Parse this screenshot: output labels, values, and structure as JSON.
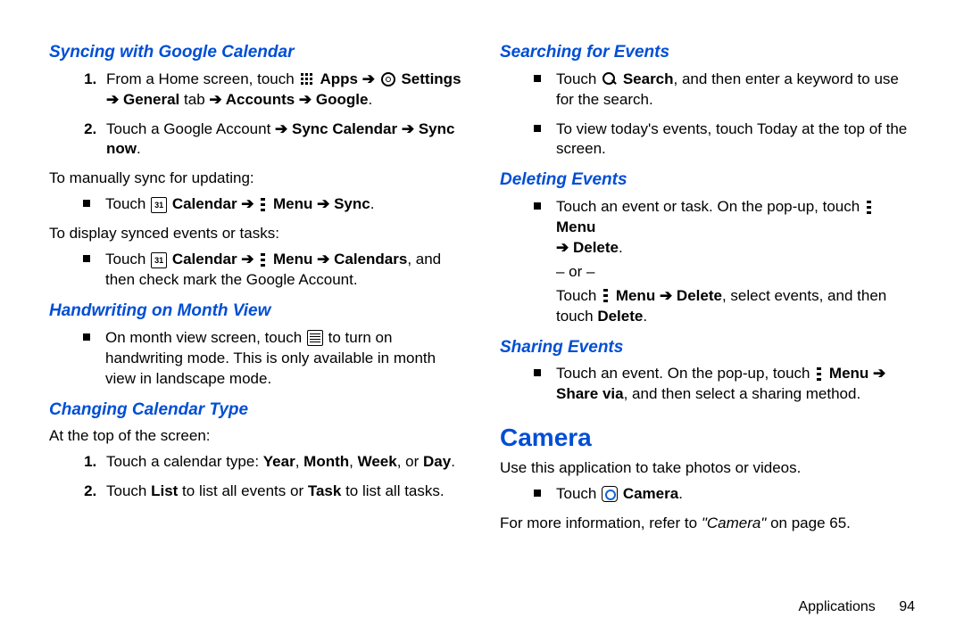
{
  "left": {
    "sync": {
      "heading": "Syncing with Google Calendar",
      "step1_a": "From a Home screen, touch ",
      "step1_apps": " Apps ",
      "step1_settings": " Settings ",
      "step1_b": " General",
      "step1_c": " tab ",
      "step1_d": " Accounts ",
      "step1_e": " Google",
      "step2_a": "Touch a Google Account ",
      "step2_b": " Sync Calendar ",
      "step2_c": " Sync now",
      "manual": "To manually sync for updating:",
      "bullet1_a": "Touch ",
      "bullet1_cal": " Calendar ",
      "bullet1_menu": " Menu ",
      "bullet1_sync": " Sync",
      "display": "To display synced events or tasks:",
      "bullet2_a": "Touch ",
      "bullet2_cal": " Calendar ",
      "bullet2_menu": " Menu ",
      "bullet2_cals": " Calendars",
      "bullet2_end": ", and then check mark the Google Account."
    },
    "handwriting": {
      "heading": "Handwriting on Month View",
      "bullet_a": "On month view screen, touch ",
      "bullet_b": " to turn on handwriting mode. This is only available in month view in landscape mode."
    },
    "changing": {
      "heading": "Changing Calendar Type",
      "intro": "At the top of the screen:",
      "step1_a": "Touch a calendar type: ",
      "year": "Year",
      "month": "Month",
      "week": "Week",
      "day": "Day",
      "step2_a": "Touch ",
      "list": "List",
      "step2_b": " to list all events or ",
      "task": "Task",
      "step2_c": " to list all tasks."
    }
  },
  "right": {
    "searching": {
      "heading": "Searching for Events",
      "b1_a": "Touch ",
      "b1_search": " Search",
      "b1_b": ", and then enter a keyword to use for the search.",
      "b2": "To view today's events, touch Today at the top of the screen."
    },
    "deleting": {
      "heading": "Deleting Events",
      "b1_a": "Touch an event or task. On the pop-up, touch ",
      "b1_menu": " Menu ",
      "b1_del": " Delete",
      "or": "– or –",
      "b2_a": "Touch ",
      "b2_menu": " Menu ",
      "b2_del": " Delete",
      "b2_b": ", select events, and then touch ",
      "b2_del2": "Delete",
      "period": "."
    },
    "sharing": {
      "heading": "Sharing Events",
      "b1_a": "Touch an event. On the pop-up, touch ",
      "b1_menu": " Menu ",
      "b1_share": "Share via",
      "b1_b": ", and then select a sharing method."
    },
    "camera": {
      "heading": "Camera",
      "intro": "Use this application to take photos or videos.",
      "bullet_a": "Touch ",
      "bullet_cam": " Camera",
      "more_a": "For more information, refer to ",
      "more_ref": "\"Camera\"",
      "more_b": " on page 65."
    }
  },
  "footer": {
    "section": "Applications",
    "page": "94"
  },
  "arrow": "➔"
}
